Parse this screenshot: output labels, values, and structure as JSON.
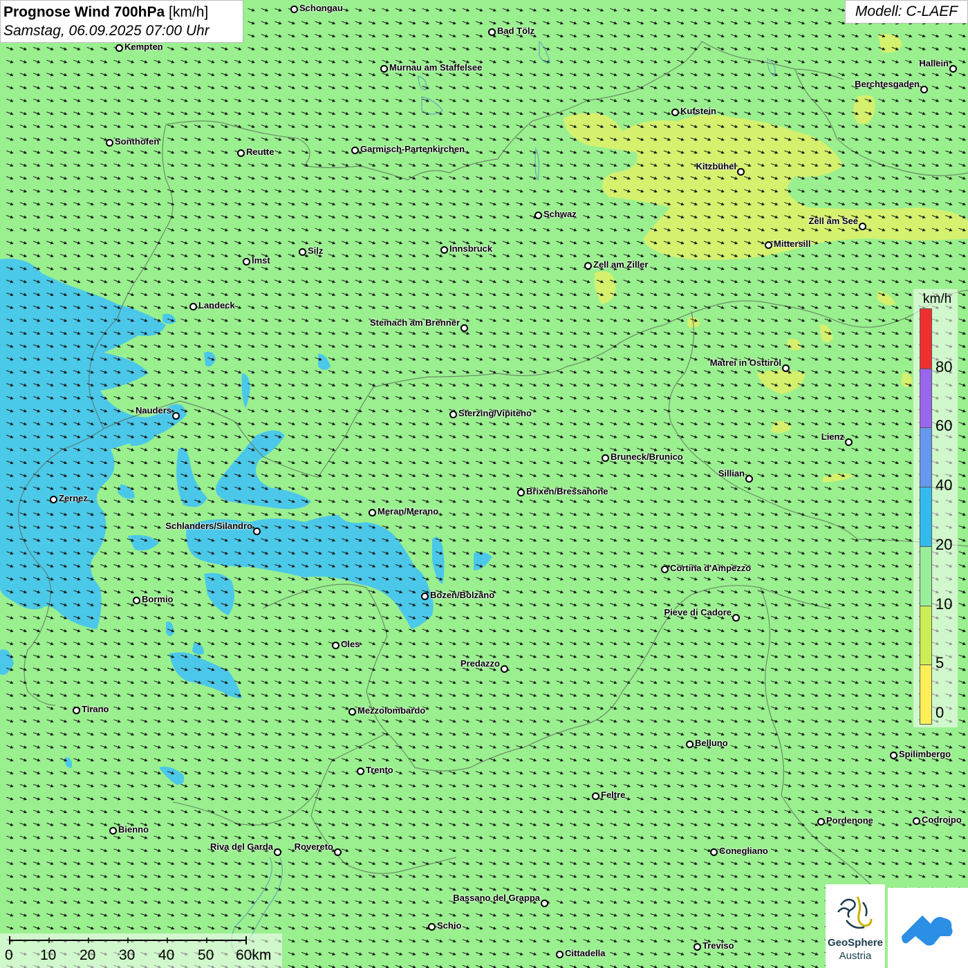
{
  "title": {
    "bold": "Prognose Wind 700hPa",
    "unit": " [km/h]",
    "datetime": "Samstag, 06.09.2025 07:00 Uhr"
  },
  "model_label": "Modell: C-LAEF",
  "legend": {
    "unit": "km/h",
    "ticks": [
      "80",
      "60",
      "40",
      "20",
      "10",
      "5",
      "0"
    ],
    "colors": [
      "#f03030",
      "#9966ee",
      "#6699ee",
      "#33bbee",
      "#99ee99",
      "#ccee55",
      "#ffee55"
    ]
  },
  "scale_bar": {
    "ticks": [
      "0",
      "10",
      "20",
      "30",
      "40",
      "50",
      "60km"
    ]
  },
  "logo": {
    "name": "GeoSphere",
    "sub": "Austria"
  },
  "colors": {
    "background": "#9af08f",
    "blue_zone": "#47c6ee",
    "yellow_zone": "#d8f06b"
  },
  "wind_direction": "from west-northwest",
  "cities": [
    {
      "name": "Schongau",
      "side": "right"
    },
    {
      "name": "Bad Tölz",
      "side": "right"
    },
    {
      "name": "Kempten",
      "side": "right"
    },
    {
      "name": "Murnau am Staffelsee",
      "side": "right"
    },
    {
      "name": "Hallein",
      "side": "left"
    },
    {
      "name": "Berchtesgaden",
      "side": "left"
    },
    {
      "name": "Kufstein",
      "side": "right"
    },
    {
      "name": "Sonthofen",
      "side": "right"
    },
    {
      "name": "Reutte",
      "side": "right"
    },
    {
      "name": "Garmisch-Partenkirchen",
      "side": "right"
    },
    {
      "name": "Kitzbühel",
      "side": "left"
    },
    {
      "name": "Schwaz",
      "side": "right"
    },
    {
      "name": "Zell am See",
      "side": "left"
    },
    {
      "name": "Mittersill",
      "side": "right"
    },
    {
      "name": "Innsbruck",
      "side": "right"
    },
    {
      "name": "Silz",
      "side": "right"
    },
    {
      "name": "Imst",
      "side": "right"
    },
    {
      "name": "Zell am Ziller",
      "side": "right"
    },
    {
      "name": "Landeck",
      "side": "right"
    },
    {
      "name": "Steinach am Brenner",
      "side": "left"
    },
    {
      "name": "Matrei in Osttirol",
      "side": "left"
    },
    {
      "name": "Nauders",
      "side": "left"
    },
    {
      "name": "Sterzing/Vipiteno",
      "side": "right"
    },
    {
      "name": "Lienz",
      "side": "left"
    },
    {
      "name": "Bruneck/Brunico",
      "side": "right"
    },
    {
      "name": "Sillian",
      "side": "left"
    },
    {
      "name": "Zernez",
      "side": "right"
    },
    {
      "name": "Brixen/Bressanone",
      "side": "right"
    },
    {
      "name": "Meran/Merano",
      "side": "right"
    },
    {
      "name": "Schlanders/Silandro",
      "side": "left"
    },
    {
      "name": "Cortina d'Ampezzo",
      "side": "right"
    },
    {
      "name": "Bozen/Bolzano",
      "side": "right"
    },
    {
      "name": "Bormio",
      "side": "right"
    },
    {
      "name": "Pieve di Cadore",
      "side": "left"
    },
    {
      "name": "Cles",
      "side": "right"
    },
    {
      "name": "Predazzo",
      "side": "left"
    },
    {
      "name": "Tirano",
      "side": "right"
    },
    {
      "name": "Mezzolombardo",
      "side": "right"
    },
    {
      "name": "Belluno",
      "side": "right"
    },
    {
      "name": "Spilimbergo",
      "side": "right"
    },
    {
      "name": "Trento",
      "side": "right"
    },
    {
      "name": "Feltre",
      "side": "right"
    },
    {
      "name": "Pordenone",
      "side": "right"
    },
    {
      "name": "Codroipo",
      "side": "right"
    },
    {
      "name": "Bienno",
      "side": "right"
    },
    {
      "name": "Riva del Garda",
      "side": "left"
    },
    {
      "name": "Rovereto",
      "side": "left"
    },
    {
      "name": "Conegliano",
      "side": "right"
    },
    {
      "name": "Bassano del Grappa",
      "side": "left"
    },
    {
      "name": "Schio",
      "side": "right"
    },
    {
      "name": "Treviso",
      "side": "right"
    },
    {
      "name": "Cittadella",
      "side": "right"
    }
  ]
}
